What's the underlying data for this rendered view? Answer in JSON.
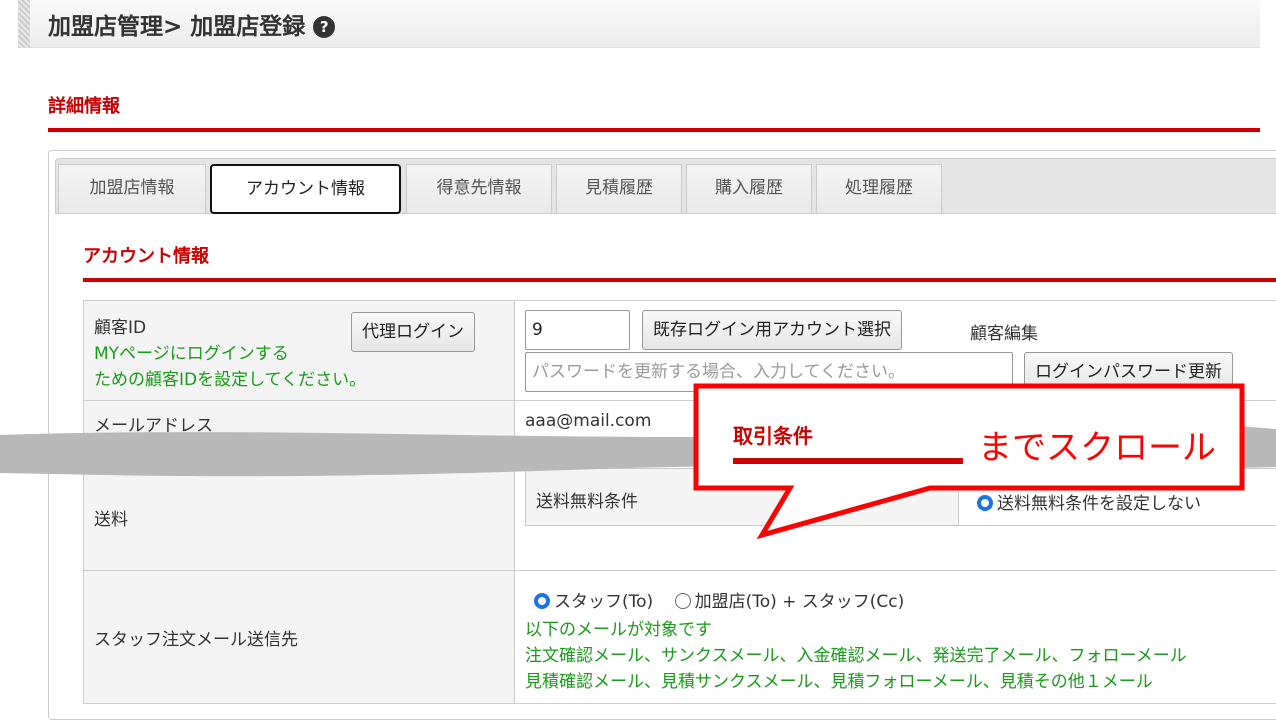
{
  "header": {
    "title": "加盟店管理> 加盟店登録",
    "help_icon": "question-circle-icon"
  },
  "section_title": "詳細情報",
  "tabs": [
    {
      "label": "加盟店情報"
    },
    {
      "label": "アカウント情報",
      "active": true
    },
    {
      "label": "得意先情報"
    },
    {
      "label": "見積履歴"
    },
    {
      "label": "購入履歴"
    },
    {
      "label": "処理履歴"
    }
  ],
  "account": {
    "title": "アカウント情報",
    "customer_id_label": "顧客ID",
    "customer_id_note1": "MYページにログインする",
    "customer_id_note2": "ための顧客IDを設定してください。",
    "proxy_login": "代理ログイン",
    "customer_id_value": "9",
    "select_account": "既存ログイン用アカウント選択",
    "customer_edit": "顧客編集",
    "password_placeholder": "パスワードを更新する場合、入力してください。",
    "update_password": "ログインパスワード更新",
    "email_label": "メールアドレス",
    "email_value": "aaa@mail.com",
    "shipping_label": "送料",
    "free_shipping_label": "送料無料条件",
    "free_shipping_option": "送料無料条件を設定しない",
    "staff_mail_label": "スタッフ注文メール送信先",
    "staff_option1": "スタッフ(To)",
    "staff_option2": "加盟店(To) + スタッフ(Cc)",
    "mail_note": "以下のメールが対象です",
    "mail_list1": "注文確認メール、サンクスメール、入金確認メール、発送完了メール、フォローメール",
    "mail_list2": "見積確認メール、見積サンクスメール、見積フォローメール、見積その他１メール"
  },
  "callout": {
    "heading": "取引条件",
    "text": "までスクロール",
    "color": "#ff0000"
  },
  "colors": {
    "accent": "#cc0000",
    "note_green": "#1a9a1a"
  }
}
